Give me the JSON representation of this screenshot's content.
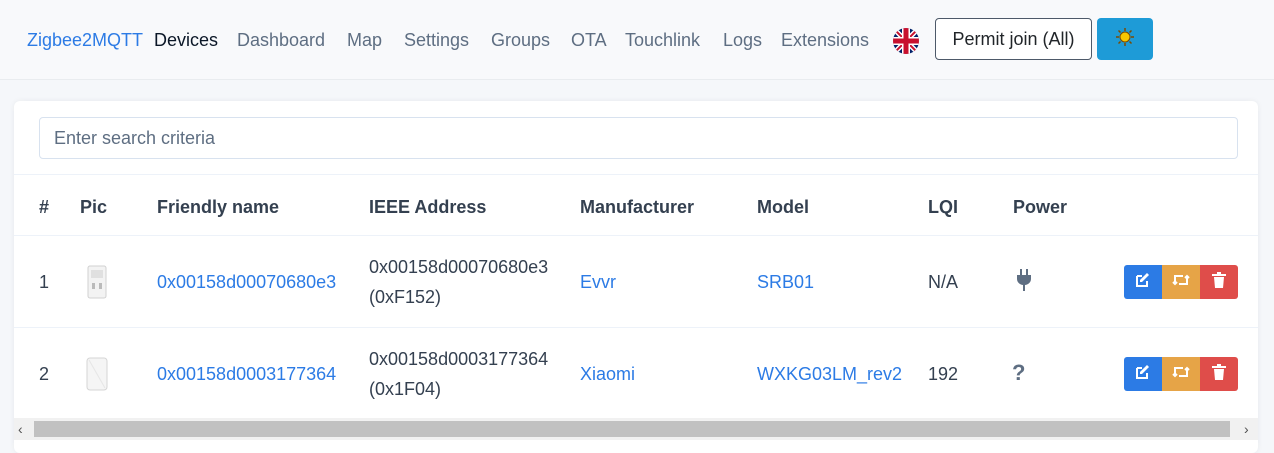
{
  "nav": {
    "brand": "Zigbee2MQTT",
    "links": [
      "Devices",
      "Dashboard",
      "Map",
      "Settings",
      "Groups",
      "OTA",
      "Touchlink",
      "Logs",
      "Extensions"
    ],
    "active": "Devices",
    "permit_join_label": "Permit join (All)",
    "theme_icon": "sun-icon",
    "language_icon": "uk-flag-icon"
  },
  "search": {
    "placeholder": "Enter search criteria"
  },
  "table": {
    "headers": [
      "#",
      "Pic",
      "Friendly name",
      "IEEE Address",
      "Manufacturer",
      "Model",
      "LQI",
      "Power"
    ],
    "rows": [
      {
        "index": "1",
        "friendly_name": "0x00158d00070680e3",
        "ieee_line1": "0x00158d00070680e3",
        "ieee_line2": "(0xF152)",
        "manufacturer": "Evvr",
        "model": "SRB01",
        "lqi": "N/A",
        "power_icon": "plug-icon",
        "power": ""
      },
      {
        "index": "2",
        "friendly_name": "0x00158d0003177364",
        "ieee_line1": "0x00158d0003177364",
        "ieee_line2": "(0x1F04)",
        "manufacturer": "Xiaomi",
        "model": "WXKG03LM_rev2",
        "lqi": "192",
        "power_icon": "unknown-icon",
        "power": "?"
      }
    ]
  },
  "colors": {
    "accent": "#2c7be5",
    "edit": "#2c7be5",
    "rename": "#e6a447",
    "delete": "#df4d4a",
    "theme_button": "#1e9bd7"
  }
}
